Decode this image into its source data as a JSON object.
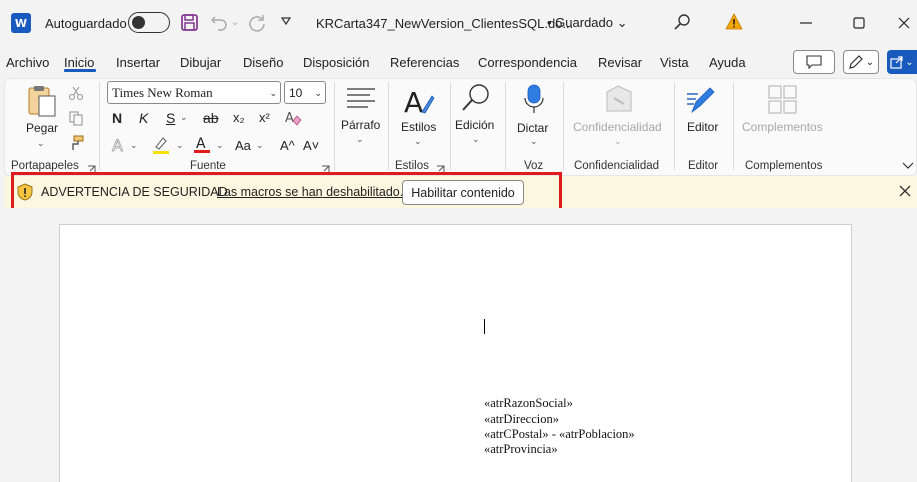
{
  "titlebar": {
    "app_icon": "word-logo-icon",
    "autosave_label": "Autoguardado",
    "autosave_state": "off",
    "document_title": "KRCarta347_NewVersion_ClientesSQL.do...",
    "save_status": "• Guardado ⌄"
  },
  "menu": {
    "tabs": [
      "Archivo",
      "Inicio",
      "Insertar",
      "Dibujar",
      "Diseño",
      "Disposición",
      "Referencias",
      "Correspondencia",
      "Revisar",
      "Vista",
      "Ayuda"
    ],
    "active_tab": "Inicio"
  },
  "ribbon": {
    "paste_label": "Pegar",
    "clipboard_group": "Portapapeles",
    "font_name": "Times New Roman",
    "font_size": "10",
    "font_group": "Fuente",
    "paragraph_label": "Párrafo",
    "styles_label": "Estilos",
    "styles_group": "Estilos",
    "editing_label": "Edición",
    "dictate_label": "Dictar",
    "voice_group": "Voz",
    "sensitivity_label": "Confidencialidad",
    "sensitivity_group": "Confidencialidad",
    "editor_label": "Editor",
    "editor_group": "Editor",
    "addins_label": "Complementos",
    "addins_group": "Complementos",
    "fmt": {
      "bold": "N",
      "italic": "K",
      "underline": "S",
      "strike": "ab",
      "subscript": "x₂",
      "superscript": "x²",
      "case": "Aa",
      "grow": "A^",
      "shrink": "A˅"
    },
    "colors": {
      "highlight": "#f5e10a",
      "font_color": "#e01b1b",
      "accent": "#185abd"
    }
  },
  "security_bar": {
    "title": "ADVERTENCIA DE SEGURIDAD",
    "message": "Las macros se han deshabilitado.",
    "button": "Habilitar contenido"
  },
  "document": {
    "lines": [
      "«atrRazonSocial»",
      "«atrDireccion»",
      "«atrCPostal» - «atrPoblacion»",
      "«atrProvincia»"
    ]
  }
}
